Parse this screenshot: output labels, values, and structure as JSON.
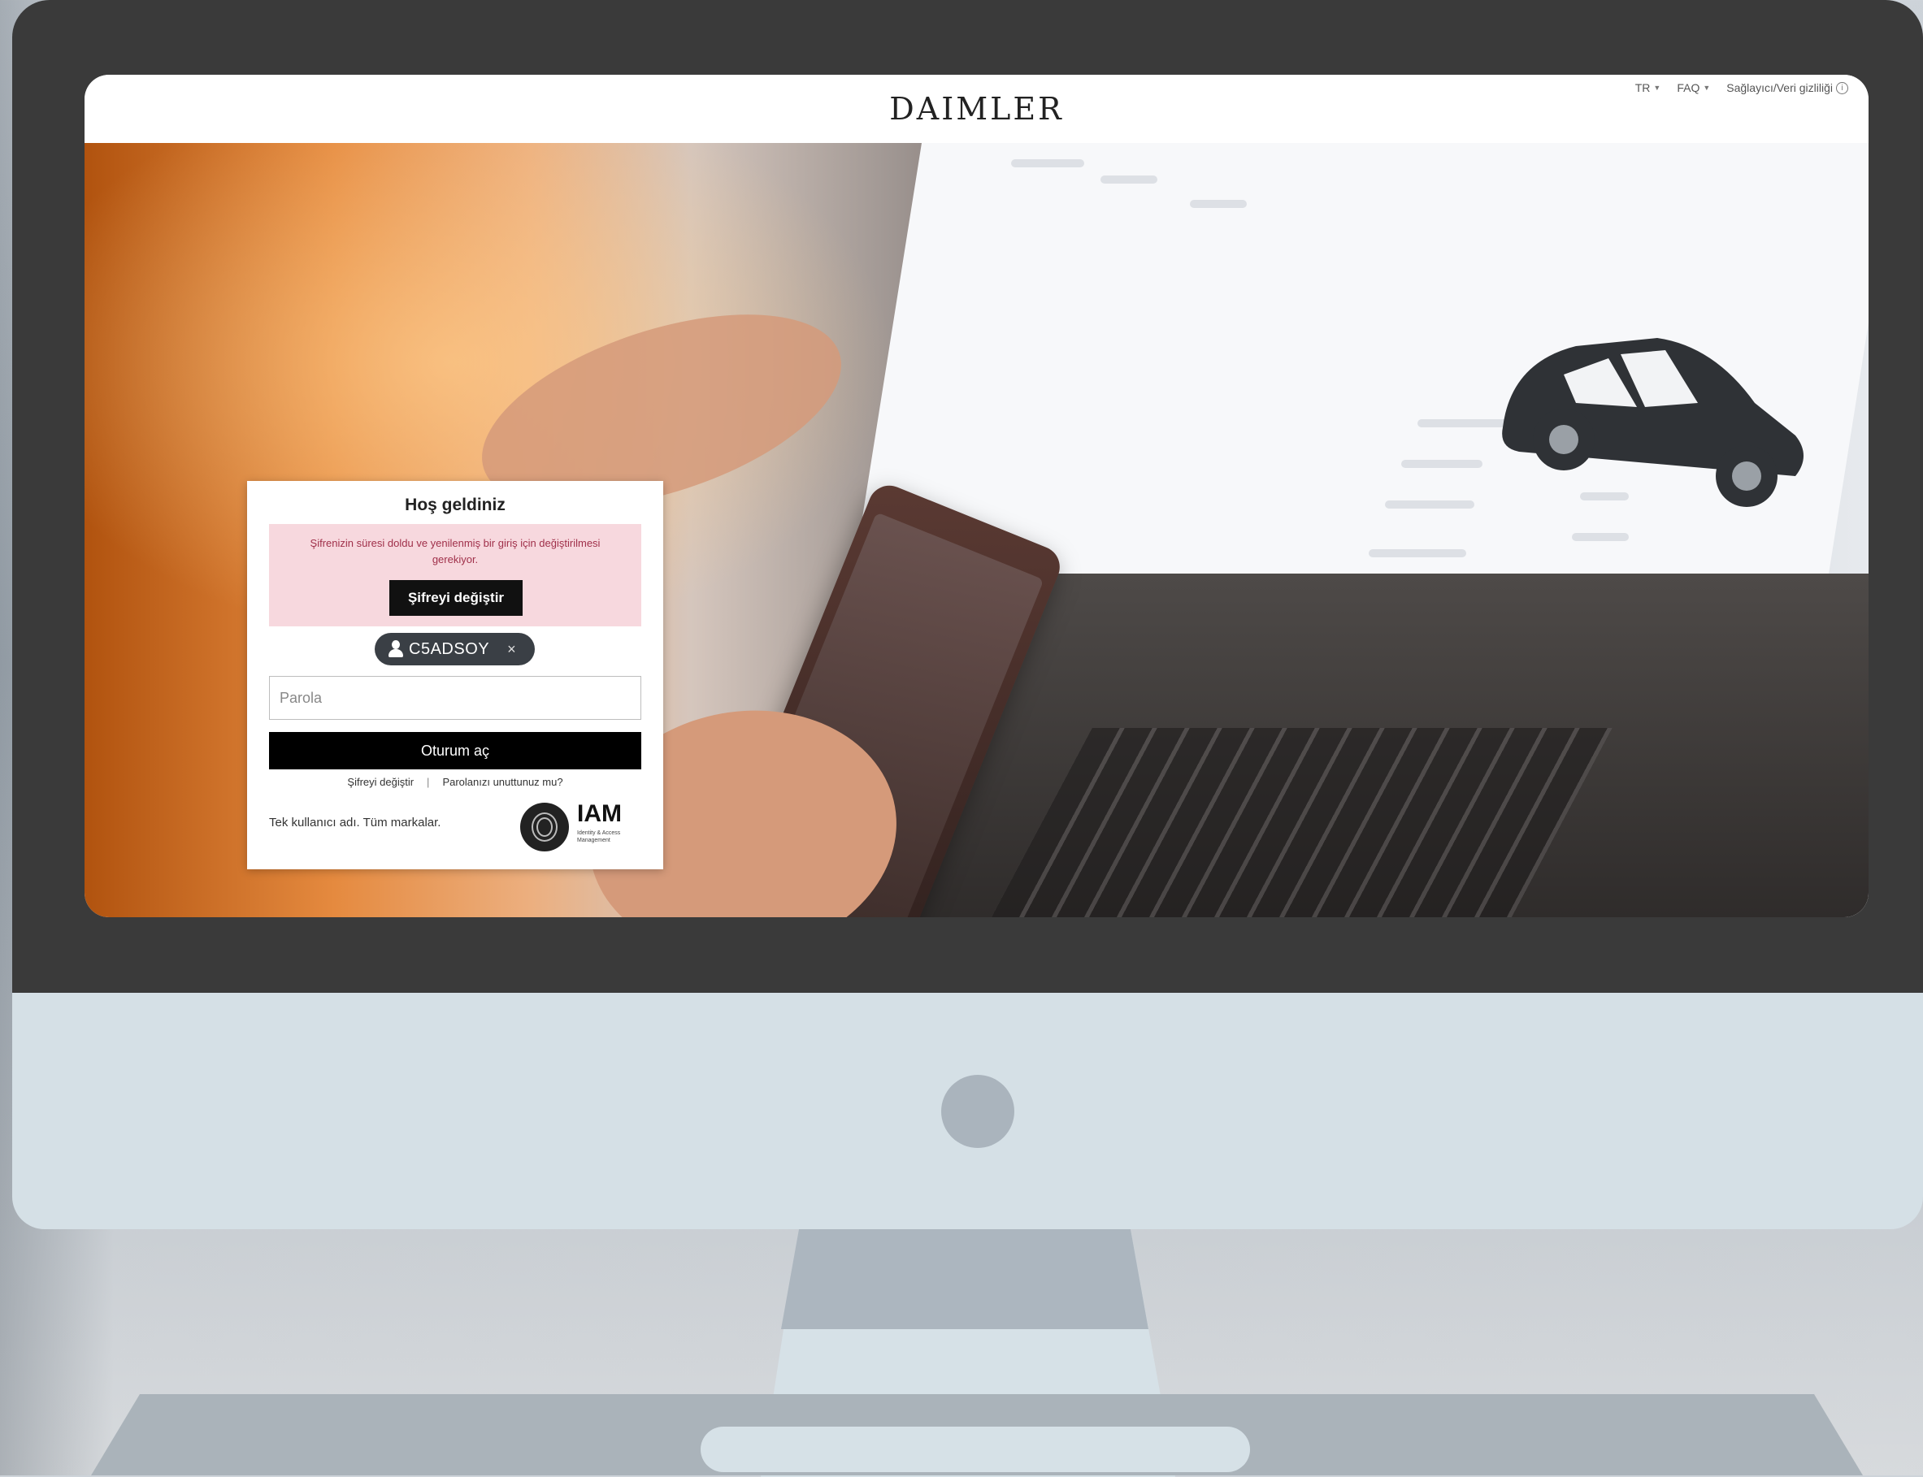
{
  "brand": "DAIMLER",
  "top_links": {
    "language": "TR",
    "faq": "FAQ",
    "privacy": "Sağlayıcı/Veri gizliliği"
  },
  "login": {
    "title": "Hoş geldiniz",
    "alert_message": "Şifrenizin süresi doldu ve yenilenmiş bir giriş için değiştirilmesi gerekiyor.",
    "alert_button": "Şifreyi değiştir",
    "username": "C5ADSOY",
    "chip_close": "×",
    "password_placeholder": "Parola",
    "submit_button": "Oturum aç",
    "change_password_link": "Şifreyi değiştir",
    "separator": "|",
    "forgot_password_link": "Parolanızı unuttunuz mu?",
    "tagline": "Tek kullanıcı adı. Tüm markalar.",
    "iam_title": "IAM",
    "iam_subtitle": "Identity & Access Management"
  },
  "colors": {
    "bezel": "#3a3a3a",
    "chin": "#d5e0e6",
    "alert_bg": "#f7d8de",
    "alert_text": "#a0304a",
    "chip": "#3a3f45",
    "button": "#000000"
  },
  "icons": [
    "user-icon",
    "close-icon",
    "chevron-down-icon",
    "info-icon",
    "fingerprint-icon",
    "car-icon",
    "apple-logo-icon"
  ]
}
